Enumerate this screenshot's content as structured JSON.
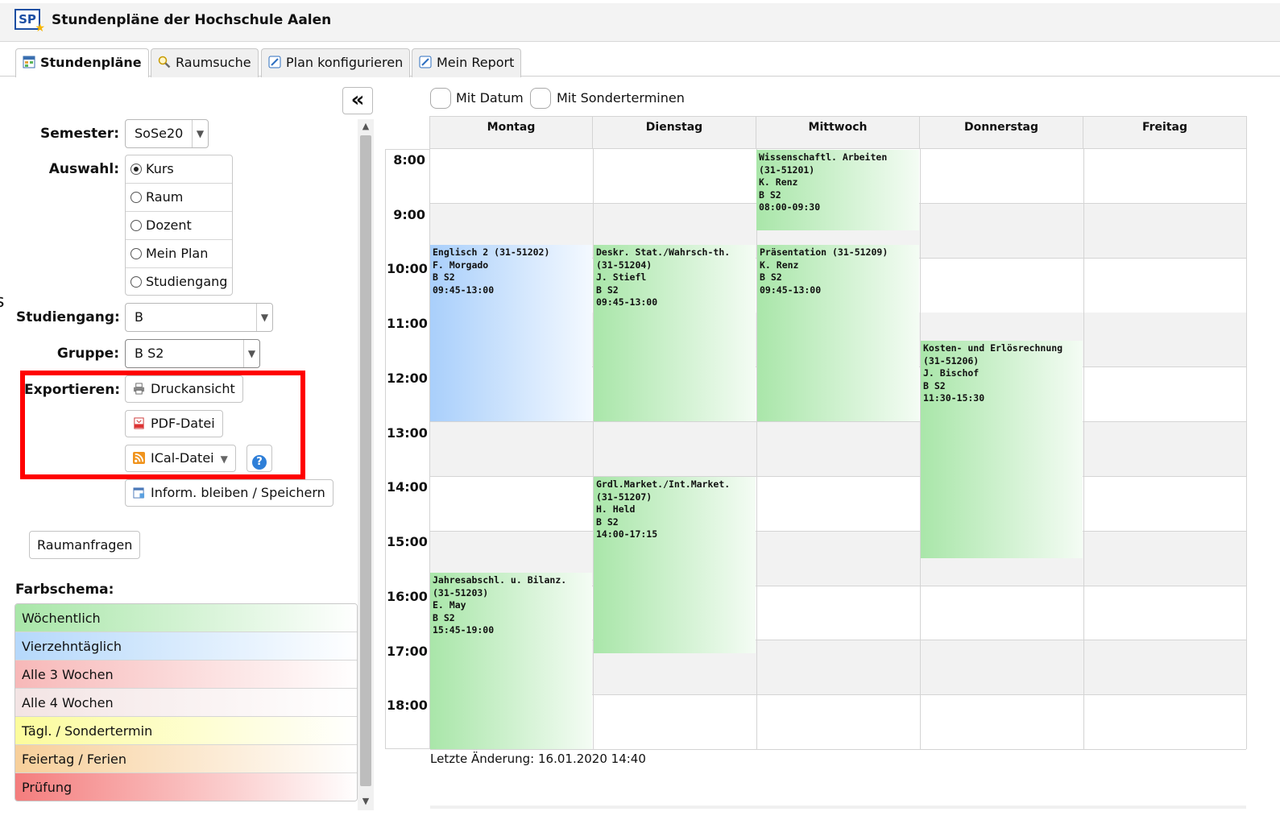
{
  "app": {
    "logo": "SP",
    "title": "Stundenpläne der Hochschule Aalen"
  },
  "tabs": [
    {
      "label": "Stundenpläne",
      "icon": "table-icon",
      "active": true
    },
    {
      "label": "Raumsuche",
      "icon": "magnifier-icon",
      "active": false
    },
    {
      "label": "Plan konfigurieren",
      "icon": "edit-icon",
      "active": false
    },
    {
      "label": "Mein Report",
      "icon": "edit-icon",
      "active": false
    }
  ],
  "sidebar": {
    "collapse": "«",
    "semester": {
      "label": "Semester:",
      "value": "SoSe20"
    },
    "auswahl": {
      "label": "Auswahl:",
      "options": [
        "Kurs",
        "Raum",
        "Dozent",
        "Mein Plan",
        "Studiengang"
      ],
      "selected": "Kurs"
    },
    "studiengang": {
      "label": "Studiengang:",
      "value": "B"
    },
    "gruppe": {
      "label": "Gruppe:",
      "value": "B S2"
    },
    "exportieren": {
      "label": "Exportieren:",
      "druckansicht": "Druckansicht",
      "pdf": "PDF-Datei",
      "ical": "ICal-Datei",
      "help": "?"
    },
    "inform": "Inform. bleiben / Speichern",
    "raumanfragen": "Raumanfragen",
    "farbschema": {
      "label": "Farbschema:",
      "items": [
        {
          "label": "Wöchentlich",
          "color": "#a8e6a8"
        },
        {
          "label": "Vierzehntäglich",
          "color": "#b5d8fb"
        },
        {
          "label": "Alle 3 Wochen",
          "color": "#f7b8b8"
        },
        {
          "label": "Alle 4 Wochen",
          "color": "#f3e4e4"
        },
        {
          "label": "Tägl. / Sondertermin",
          "color": "#fcfc9c"
        },
        {
          "label": "Feiertag / Ferien",
          "color": "#f7cf9a"
        },
        {
          "label": "Prüfung",
          "color": "#f47d7d"
        }
      ]
    }
  },
  "plan": {
    "mit_datum": "Mit Datum",
    "mit_sonderterminen": "Mit Sonderterminen",
    "days": [
      "Montag",
      "Dienstag",
      "Mittwoch",
      "Donnerstag",
      "Freitag"
    ],
    "times": [
      "8:00",
      "9:00",
      "10:00",
      "11:00",
      "12:00",
      "13:00",
      "14:00",
      "15:00",
      "16:00",
      "17:00",
      "18:00"
    ],
    "events": [
      {
        "lines": [
          "Wissenschaftl. Arbeiten",
          "(31-51201)",
          "K. Renz",
          "B S2",
          "08:00-09:30"
        ],
        "type": "green"
      },
      {
        "lines": [
          "Englisch 2 (31-51202)",
          "F. Morgado",
          "B S2",
          "09:45-13:00"
        ],
        "type": "blue"
      },
      {
        "lines": [
          "Deskr. Stat./Wahrsch-th.",
          "(31-51204)",
          "J. Stiefl",
          "B S2",
          "09:45-13:00"
        ],
        "type": "green"
      },
      {
        "lines": [
          "Präsentation (31-51209)",
          "K. Renz",
          "B S2",
          "09:45-13:00"
        ],
        "type": "green"
      },
      {
        "lines": [
          "Kosten- und Erlösrechnung",
          "(31-51206)",
          "J. Bischof",
          "B S2",
          "11:30-15:30"
        ],
        "type": "green"
      },
      {
        "lines": [
          "Grdl.Market./Int.Market.",
          "(31-51207)",
          "H. Held",
          "B S2",
          "14:00-17:15"
        ],
        "type": "green"
      },
      {
        "lines": [
          "Jahresabschl. u. Bilanz.",
          "(31-51203)",
          "E. May",
          "B S2",
          "15:45-19:00"
        ],
        "type": "green"
      }
    ],
    "last_change": "Letzte Änderung: 16.01.2020 14:40"
  }
}
